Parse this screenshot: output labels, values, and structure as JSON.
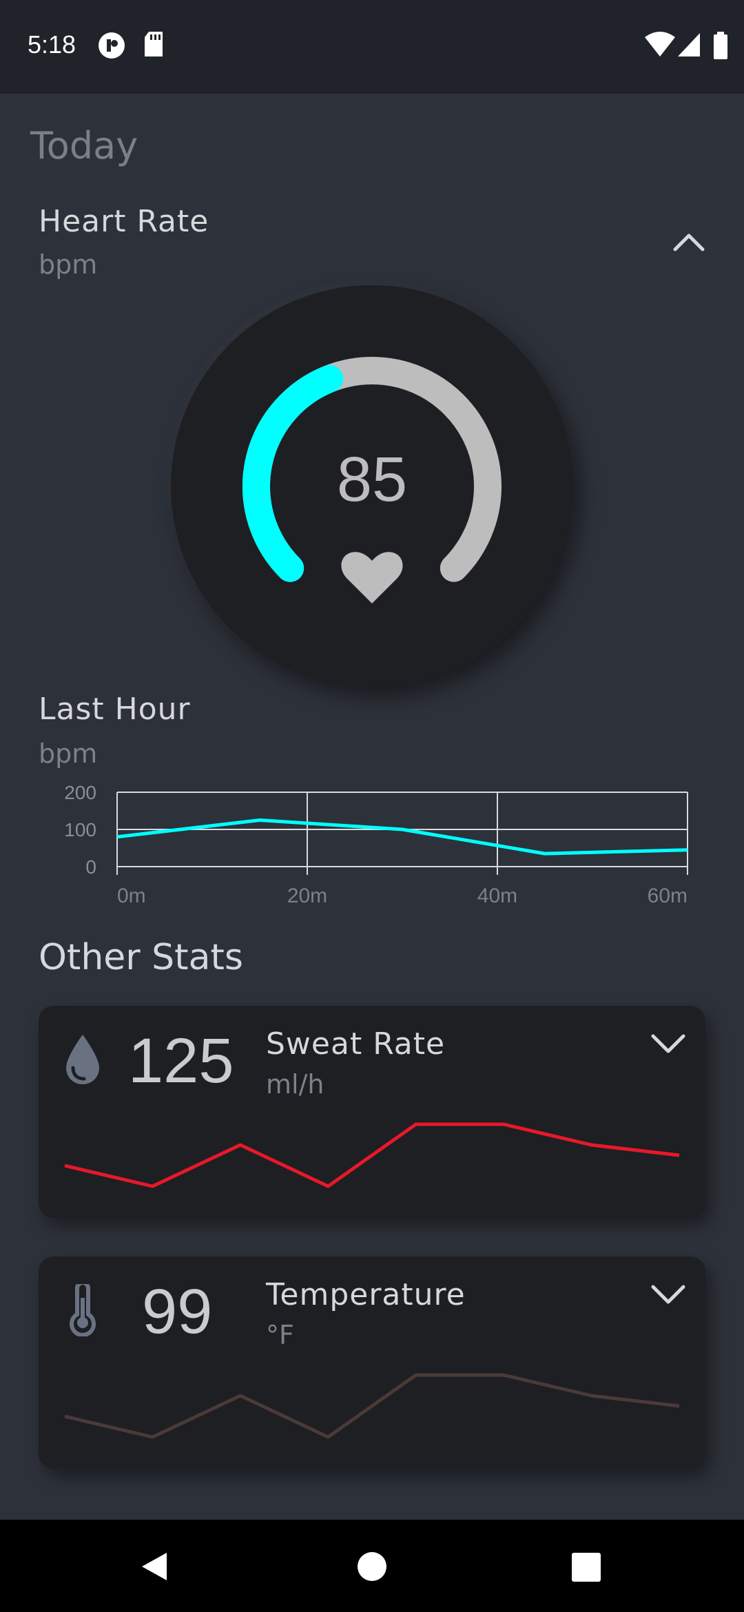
{
  "status_bar": {
    "time": "5:18"
  },
  "header": {
    "title": "Today"
  },
  "heart_rate": {
    "title": "Heart Rate",
    "unit": "bpm",
    "value": "85",
    "gauge_fraction": 0.42,
    "colors": {
      "active": "#00ffff",
      "track": "#bdbdbd"
    }
  },
  "last_hour": {
    "title": "Last Hour",
    "unit": "bpm"
  },
  "chart_data": {
    "type": "line",
    "x": [
      0,
      15,
      30,
      45,
      60
    ],
    "series": [
      {
        "values": [
          80,
          125,
          100,
          35,
          45
        ],
        "color": "#00ffff"
      }
    ],
    "xticks": [
      "0m",
      "20m",
      "40m",
      "60m"
    ],
    "xtick_values": [
      0,
      20,
      40,
      60
    ],
    "yticks": [
      "0",
      "100",
      "200"
    ],
    "ytick_values": [
      0,
      100,
      200
    ],
    "xlim": [
      0,
      60
    ],
    "ylim": [
      0,
      200
    ],
    "grid": true
  },
  "other_stats": {
    "title": "Other Stats",
    "cards": [
      {
        "icon": "water-drop-icon",
        "value": "125",
        "name": "Sweat Rate",
        "unit": "ml/h",
        "trend": [
          3,
          1,
          5,
          1,
          7,
          7,
          5,
          4
        ],
        "trend_color": "#e8182a"
      },
      {
        "icon": "thermometer-icon",
        "value": "99",
        "name": "Temperature",
        "unit": "°F",
        "trend": [
          3,
          1,
          5,
          1,
          7,
          7,
          5,
          4
        ],
        "trend_color": "#4a3a38"
      }
    ]
  },
  "nav": {
    "back": "back-icon",
    "home": "home-icon",
    "recents": "recents-icon"
  }
}
